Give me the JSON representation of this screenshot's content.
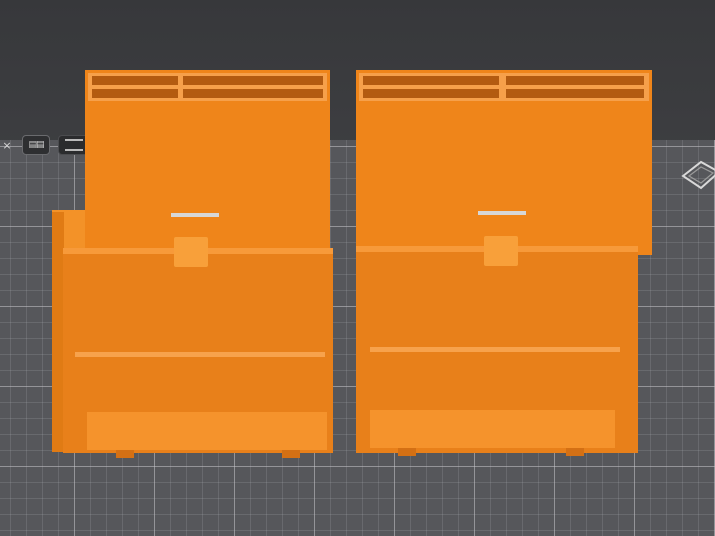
{
  "viewport": {
    "name": "3d-slicer-viewport",
    "model_color": "#f0861a",
    "model_shadow_color": "#c9660e",
    "bed_color": "#56575b",
    "background_color": "#3a3b3e"
  },
  "toolbar": {
    "close_glyph": "×",
    "layout_glyph": "▤▤"
  },
  "icons": [
    "close-icon",
    "layout-icon",
    "layers-icon",
    "orientation-cube-icon"
  ]
}
